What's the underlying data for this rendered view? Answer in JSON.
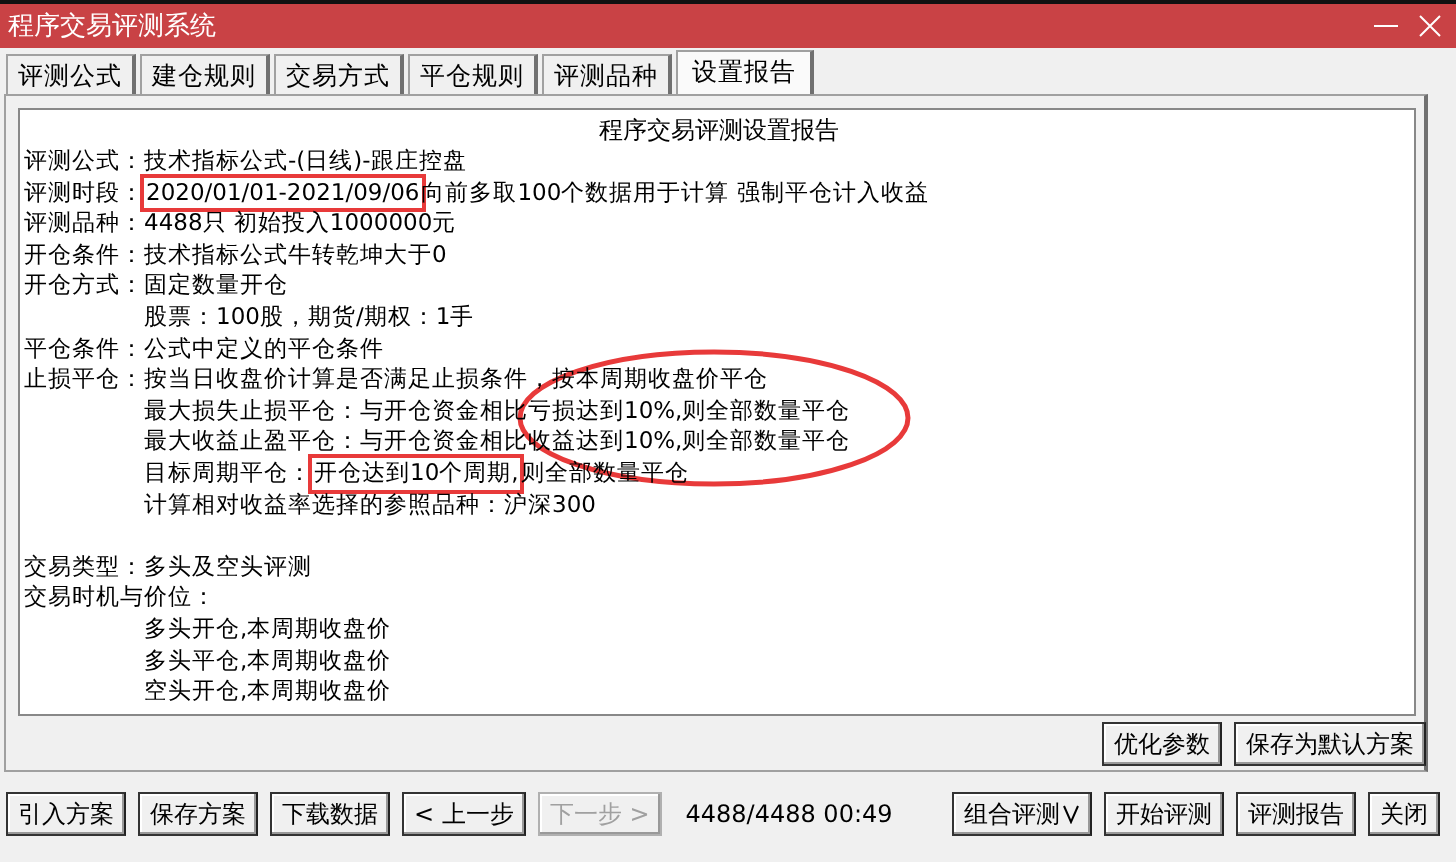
{
  "window": {
    "title": "程序交易评测系统"
  },
  "tabs": [
    {
      "label": "评测公式",
      "selected": false
    },
    {
      "label": "建仓规则",
      "selected": false
    },
    {
      "label": "交易方式",
      "selected": false
    },
    {
      "label": "平仓规则",
      "selected": false
    },
    {
      "label": "评测品种",
      "selected": false
    },
    {
      "label": "设置报告",
      "selected": true
    }
  ],
  "report": {
    "title": "程序交易评测设置报告",
    "lines": [
      {
        "kind": "field",
        "label": "评测公式：",
        "segments": [
          {
            "text": "技术指标公式-(日线)-跟庄控盘",
            "boxed": false
          }
        ]
      },
      {
        "kind": "field",
        "label": "评测时段：",
        "segments": [
          {
            "text": "2020/01/01-2021/09/06",
            "boxed": true
          },
          {
            "text": "向前多取100个数据用于计算 强制平仓计入收益",
            "boxed": false
          }
        ]
      },
      {
        "kind": "field",
        "label": "评测品种：",
        "segments": [
          {
            "text": "4488只 初始投入1000000元",
            "boxed": false
          }
        ]
      },
      {
        "kind": "field",
        "label": "开仓条件：",
        "segments": [
          {
            "text": "技术指标公式牛转乾坤大于0",
            "boxed": false
          }
        ]
      },
      {
        "kind": "field",
        "label": "开仓方式：",
        "segments": [
          {
            "text": "固定数量开仓",
            "boxed": false
          }
        ]
      },
      {
        "kind": "cont",
        "segments": [
          {
            "text": "股票：100股，期货/期权：1手",
            "boxed": false
          }
        ]
      },
      {
        "kind": "field",
        "label": "平仓条件：",
        "segments": [
          {
            "text": "公式中定义的平仓条件",
            "boxed": false
          }
        ]
      },
      {
        "kind": "field",
        "label": "止损平仓：",
        "segments": [
          {
            "text": "按当日收盘价计算是否满足止损条件，按本周期收盘价平仓",
            "boxed": false
          }
        ]
      },
      {
        "kind": "cont",
        "segments": [
          {
            "text": "最大损失止损平仓：与开仓资金相比亏损达到10%,则全部数量平仓",
            "boxed": false
          }
        ]
      },
      {
        "kind": "cont",
        "segments": [
          {
            "text": "最大收益止盈平仓：与开仓资金相比收益达到10%,则全部数量平仓",
            "boxed": false
          }
        ]
      },
      {
        "kind": "cont",
        "segments": [
          {
            "text": "目标周期平仓：",
            "boxed": false
          },
          {
            "text": "开仓达到10个周期,",
            "boxed": true
          },
          {
            "text": "则全部数量平仓",
            "boxed": false
          }
        ]
      },
      {
        "kind": "cont",
        "segments": [
          {
            "text": "计算相对收益率选择的参照品种：沪深300",
            "boxed": false
          }
        ]
      },
      {
        "kind": "gap"
      },
      {
        "kind": "field",
        "label": "交易类型：",
        "segments": [
          {
            "text": "多头及空头评测",
            "boxed": false
          }
        ]
      },
      {
        "kind": "heading",
        "label": "交易时机与价位："
      },
      {
        "kind": "cont",
        "segments": [
          {
            "text": "多头开仓,本周期收盘价",
            "boxed": false
          }
        ]
      },
      {
        "kind": "cont",
        "segments": [
          {
            "text": "多头平仓,本周期收盘价",
            "boxed": false
          }
        ]
      },
      {
        "kind": "cont",
        "segments": [
          {
            "text": "空头开仓,本周期收盘价",
            "boxed": false
          }
        ]
      }
    ]
  },
  "option_buttons": [
    {
      "label": "优化参数"
    },
    {
      "label": "保存为默认方案"
    }
  ],
  "left_buttons": [
    {
      "label": "引入方案",
      "disabled": false
    },
    {
      "label": "保存方案",
      "disabled": false
    },
    {
      "label": "下载数据",
      "disabled": false
    },
    {
      "label": "< 上一步",
      "disabled": false
    },
    {
      "label": "下一步 >",
      "disabled": true
    }
  ],
  "status": "4488/4488 00:49",
  "right_buttons": [
    {
      "label": "组合评测",
      "kind": "dropdown"
    },
    {
      "label": "开始评测",
      "kind": "plain"
    },
    {
      "label": "评测报告",
      "kind": "plain"
    },
    {
      "label": "关闭",
      "kind": "plain"
    }
  ]
}
